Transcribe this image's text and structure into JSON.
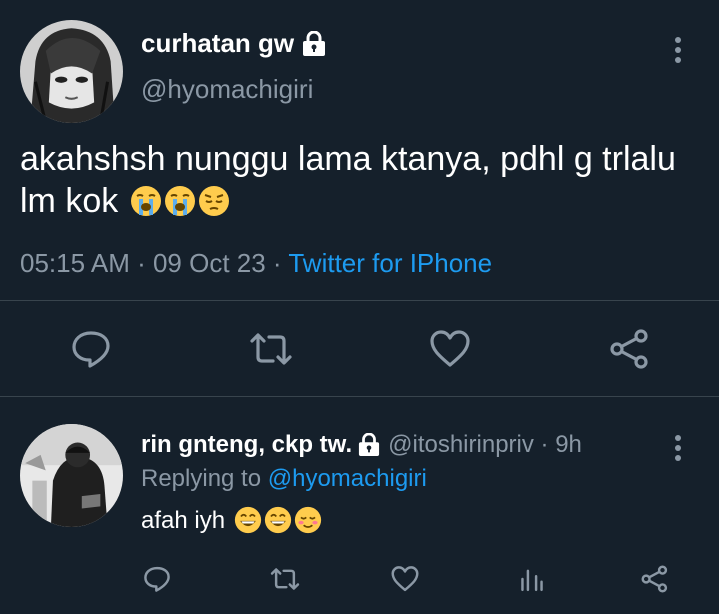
{
  "main_tweet": {
    "display_name": "curhatan gw",
    "handle": "@hyomachigiri",
    "text": "akahshsh nunggu lama ktanya, pdhl g trlalu lm kok",
    "emojis": [
      "loudly-crying-face",
      "loudly-crying-face",
      "pensive-face"
    ],
    "time": "05:15 AM",
    "sep1": " · ",
    "date": "09 Oct 23",
    "sep2": " · ",
    "source": "Twitter for IPhone",
    "actions": [
      "reply-icon",
      "retweet-icon",
      "like-icon",
      "share-icon"
    ]
  },
  "reply_tweet": {
    "display_name": "rin gnteng, ckp tw.",
    "handle_time": "@itoshirinpriv · 9h",
    "replying_label": "Replying to ",
    "replying_mention": "@hyomachigiri",
    "text": "afah iyh",
    "emojis": [
      "grinning-face",
      "grinning-face",
      "smiling-face"
    ],
    "actions": [
      "reply-icon",
      "retweet-icon",
      "like-icon",
      "analytics-icon",
      "share-icon"
    ]
  },
  "colors": {
    "background": "#15202b",
    "text": "#ffffff",
    "muted": "#8b98a5",
    "accent": "#1d9bf0",
    "divider": "#38444d"
  }
}
